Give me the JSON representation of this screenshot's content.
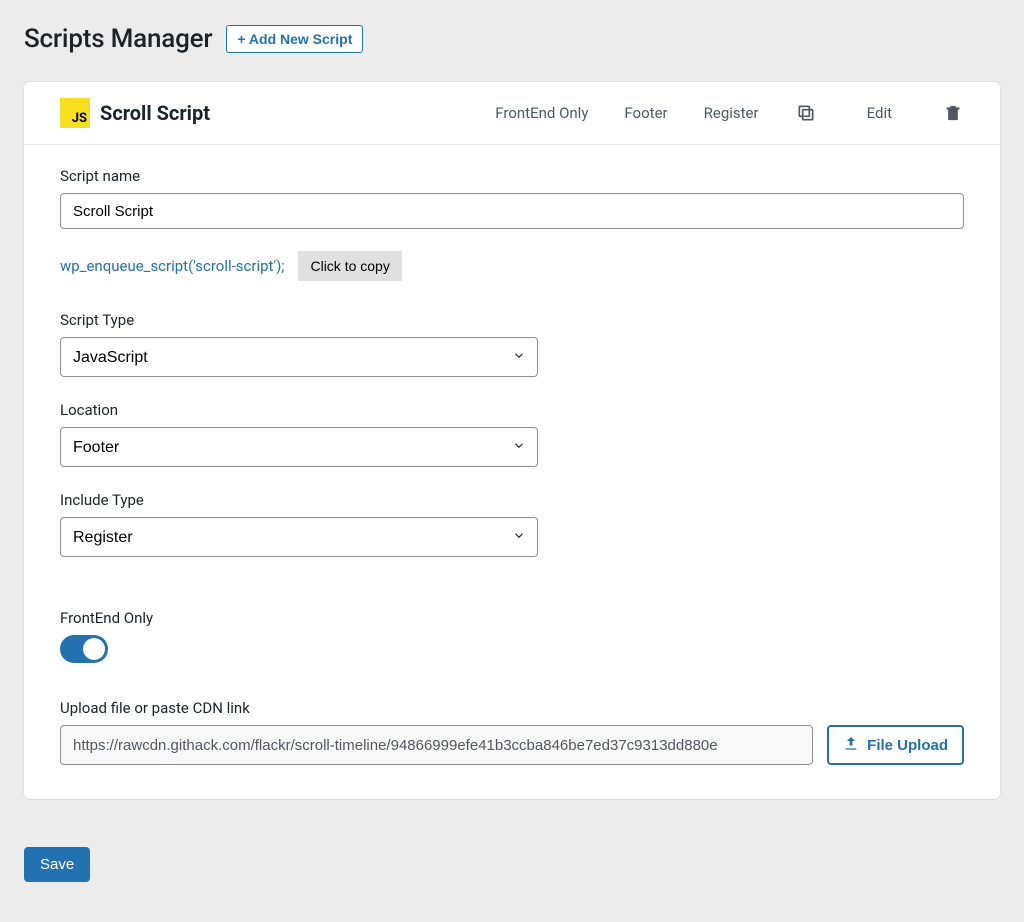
{
  "header": {
    "title": "Scripts Manager",
    "add_new_label": "+ Add New Script"
  },
  "colors": {
    "accent": "#2271b1",
    "js_badge_bg": "#f7df1e"
  },
  "script": {
    "badge_text": "JS",
    "title": "Scroll Script",
    "meta": {
      "scope": "FrontEnd Only",
      "location": "Footer",
      "include_type": "Register"
    },
    "actions": {
      "edit_label": "Edit"
    }
  },
  "form": {
    "name_label": "Script name",
    "name_value": "Scroll Script",
    "enqueue_snippet": "wp_enqueue_script('scroll-script');",
    "copy_label": "Click to copy",
    "type_label": "Script Type",
    "type_value": "JavaScript",
    "location_label": "Location",
    "location_value": "Footer",
    "include_label": "Include Type",
    "include_value": "Register",
    "frontend_label": "FrontEnd Only",
    "frontend_on": true,
    "cdn_label": "Upload file or paste CDN link",
    "cdn_value": "https://rawcdn.githack.com/flackr/scroll-timeline/94866999efe41b3ccba846be7ed37c9313dd880e",
    "upload_label": "File Upload"
  },
  "footer": {
    "save_label": "Save"
  }
}
